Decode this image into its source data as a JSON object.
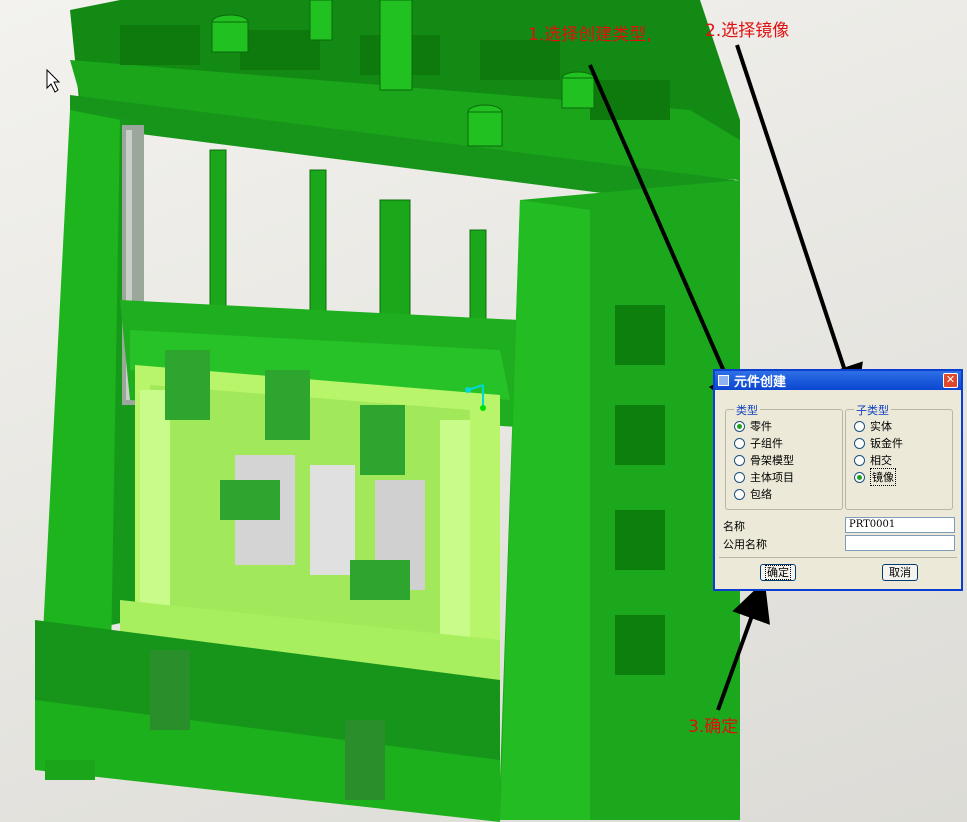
{
  "annotations": {
    "step1": "1.选择创建类型,",
    "step2": "2.选择镜像",
    "step3": "3.确定"
  },
  "dialog": {
    "title": "元件创建",
    "type_group": {
      "label": "类型",
      "options": [
        "零件",
        "子组件",
        "骨架模型",
        "主体项目",
        "包络"
      ],
      "selected": "零件"
    },
    "subtype_group": {
      "label": "子类型",
      "options": [
        "实体",
        "钣金件",
        "相交",
        "镜像"
      ],
      "selected": "镜像"
    },
    "name_label": "名称",
    "name_value": "PRT0001",
    "common_name_label": "公用名称",
    "common_name_value": "",
    "ok_label": "确定",
    "cancel_label": "取消"
  },
  "colors": {
    "frame_green": "#1fb81f",
    "die_light_green": "#a8f060",
    "annotation_red": "#e01010",
    "titlebar_blue": "#0a46d0"
  }
}
